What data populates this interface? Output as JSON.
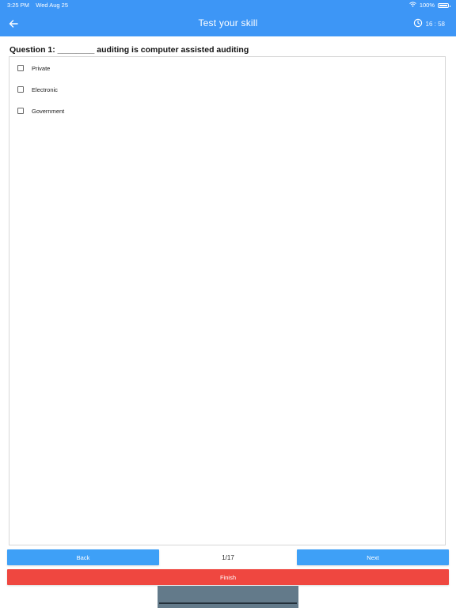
{
  "status_bar": {
    "time": "3:25 PM",
    "date": "Wed Aug 25",
    "battery_percent": "100%"
  },
  "header": {
    "title": "Test your skill",
    "timer": "16 : 58",
    "accent_color": "#3d96f6"
  },
  "question": {
    "text": "Question 1: ________ auditing is computer assisted auditing"
  },
  "options": [
    {
      "label": "Private",
      "checked": false
    },
    {
      "label": "Electronic",
      "checked": false
    },
    {
      "label": "Government",
      "checked": false
    }
  ],
  "navigation": {
    "back_label": "Back",
    "next_label": "Next",
    "page_indicator": "1/17",
    "finish_label": "Finish",
    "primary_color": "#3ea0f7",
    "finish_color": "#ef4740"
  },
  "icons": {
    "back": "arrow-left-icon",
    "timer": "clock-icon",
    "wifi": "wifi-icon",
    "battery": "battery-icon"
  }
}
